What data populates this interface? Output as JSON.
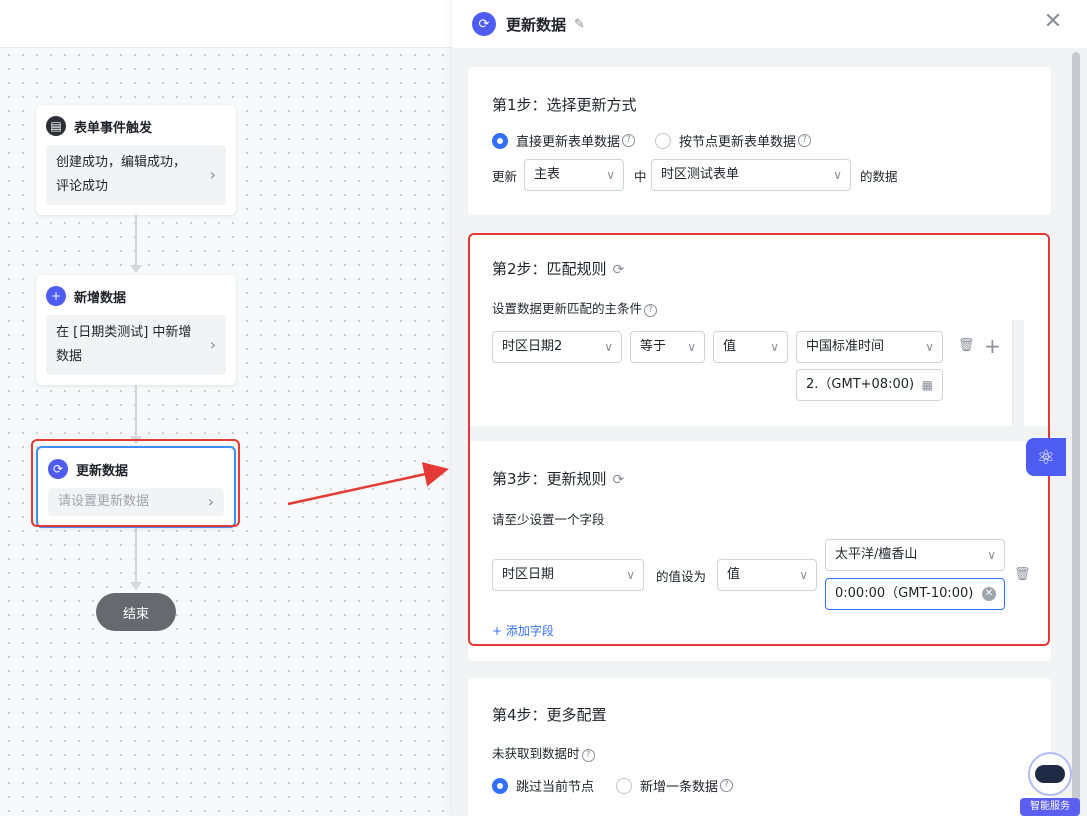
{
  "flow": {
    "trigger": {
      "title": "表单事件触发",
      "body": "创建成功，编辑成功，评论成功"
    },
    "add": {
      "title": "新增数据",
      "body": "在 [日期类测试] 中新增数据"
    },
    "update": {
      "title": "更新数据",
      "body": "请设置更新数据"
    },
    "end": {
      "label": "结束"
    }
  },
  "panel": {
    "title": "更新数据",
    "step1": {
      "title": "第1步：选择更新方式",
      "option_direct": "直接更新表单数据",
      "option_node": "按节点更新表单数据",
      "update_label": "更新",
      "table_select": "主表",
      "in_label": "中",
      "form_select": "时区测试表单",
      "suffix": "的数据"
    },
    "step2": {
      "title": "第2步：匹配规则",
      "subtitle": "设置数据更新匹配的主条件",
      "field": "时区日期2",
      "operator": "等于",
      "value_type": "值",
      "timezone": "中国标准时间",
      "date_value": "2.（GMT+08:00)"
    },
    "step3": {
      "title": "第3步：更新规则",
      "subtitle": "请至少设置一个字段",
      "field": "时区日期",
      "set_label": "的值设为",
      "value_type": "值",
      "timezone": "太平洋/檀香山",
      "time_value": "0:00:00（GMT-10:00)",
      "add_field": "添加字段"
    },
    "step4": {
      "title": "第4步：更多配置",
      "subtitle": "未获取到数据时",
      "option_skip": "跳过当前节点",
      "option_add": "新增一条数据"
    }
  },
  "smart_service": {
    "label": "智能服务"
  },
  "colors": {
    "accent": "#3370ff",
    "brand": "#4e5cf2",
    "highlight": "#e53935"
  }
}
